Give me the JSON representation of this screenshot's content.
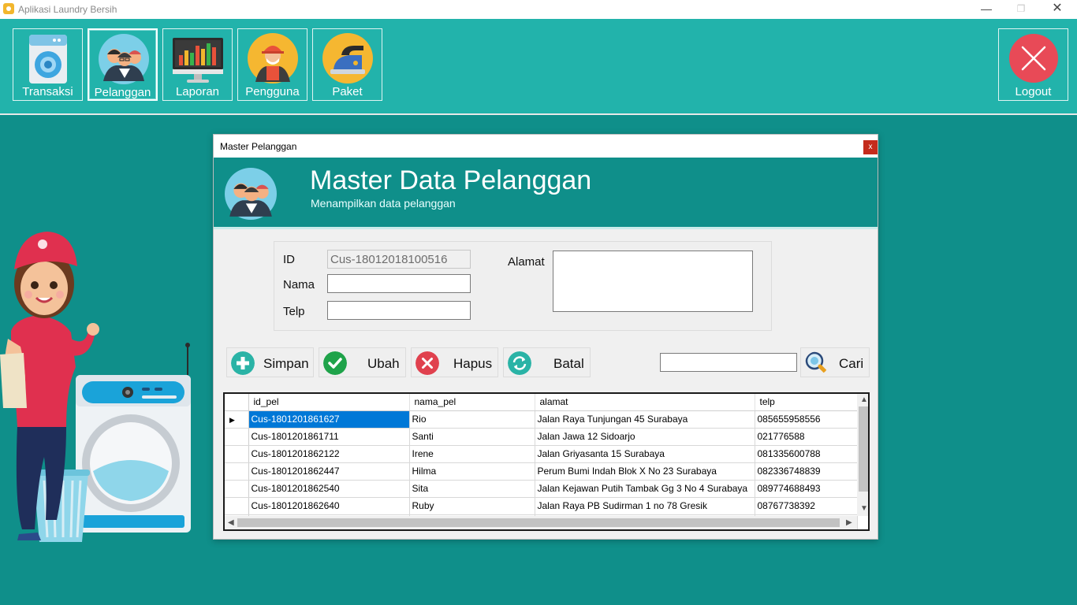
{
  "app": {
    "title": "Aplikasi Laundry Bersih"
  },
  "window_controls": {
    "minimize": "—",
    "maximize": "❐",
    "close": "✕"
  },
  "toolbar": {
    "items": [
      {
        "label": "Transaksi",
        "icon": "washing-machine-icon"
      },
      {
        "label": "Pelanggan",
        "icon": "customers-icon",
        "active": true
      },
      {
        "label": "Laporan",
        "icon": "report-chart-icon"
      },
      {
        "label": "Pengguna",
        "icon": "worker-icon"
      },
      {
        "label": "Paket",
        "icon": "iron-icon"
      }
    ],
    "logout": {
      "label": "Logout",
      "icon": "close-circle-icon"
    }
  },
  "dialog": {
    "title": "Master Pelanggan",
    "close": "x",
    "header": {
      "title": "Master Data Pelanggan",
      "subtitle": "Menampilkan data pelanggan"
    },
    "form": {
      "id_label": "ID",
      "id_value": "Cus-18012018100516",
      "nama_label": "Nama",
      "nama_value": "",
      "telp_label": "Telp",
      "telp_value": "",
      "alamat_label": "Alamat",
      "alamat_value": ""
    },
    "buttons": {
      "simpan": "Simpan",
      "ubah": "Ubah",
      "hapus": "Hapus",
      "batal": "Batal",
      "cari": "Cari"
    },
    "search_value": "",
    "grid": {
      "columns": [
        "id_pel",
        "nama_pel",
        "alamat",
        "telp"
      ],
      "rows": [
        [
          "Cus-1801201861627",
          "Rio",
          "Jalan Raya Tunjungan 45 Surabaya",
          "085655958556"
        ],
        [
          "Cus-1801201861711",
          "Santi",
          "Jalan Jawa 12 Sidoarjo",
          "021776588"
        ],
        [
          "Cus-1801201862122",
          "Irene",
          "Jalan Griyasanta 15 Surabaya",
          "081335600788"
        ],
        [
          "Cus-1801201862447",
          "Hilma",
          "Perum Bumi Indah Blok X No 23 Surabaya",
          "082336748839"
        ],
        [
          "Cus-1801201862540",
          "Sita",
          "Jalan Kejawan Putih Tambak Gg 3 No 4 Surabaya",
          "089774688493"
        ],
        [
          "Cus-1801201862640",
          "Ruby",
          "Jalan Raya PB Sudirman 1 no 78 Gresik",
          "08767738392"
        ]
      ]
    }
  },
  "colors": {
    "teal": "#0f8f8a",
    "toolbar": "#22b3ab",
    "selection": "#0078d7",
    "logout_red": "#e84a57"
  }
}
